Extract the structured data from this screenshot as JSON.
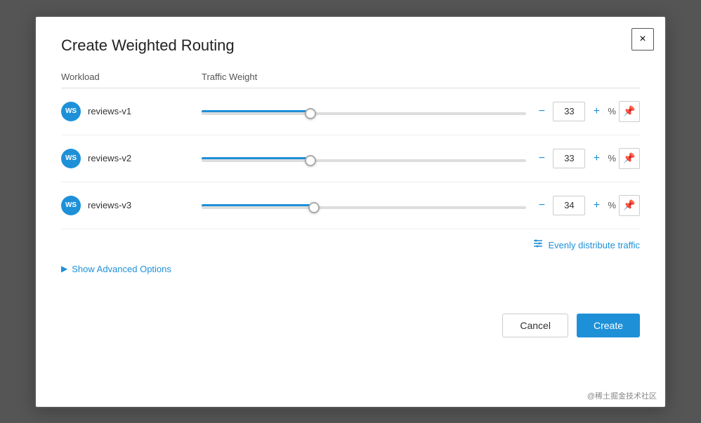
{
  "modal": {
    "title": "Create Weighted Routing",
    "close_label": "×"
  },
  "table": {
    "col_workload": "Workload",
    "col_traffic": "Traffic Weight"
  },
  "rows": [
    {
      "id": "reviews-v1",
      "badge": "WS",
      "name": "reviews-v1",
      "weight": 33,
      "fill_pct": 33
    },
    {
      "id": "reviews-v2",
      "badge": "WS",
      "name": "reviews-v2",
      "weight": 33,
      "fill_pct": 33
    },
    {
      "id": "reviews-v3",
      "badge": "WS",
      "name": "reviews-v3",
      "weight": 34,
      "fill_pct": 34
    }
  ],
  "distribute": {
    "label": "Evenly distribute traffic",
    "icon": "⑃"
  },
  "advanced": {
    "label": "Show Advanced Options"
  },
  "footer": {
    "cancel": "Cancel",
    "create": "Create"
  },
  "watermark": "@稀土掘金技术社区"
}
